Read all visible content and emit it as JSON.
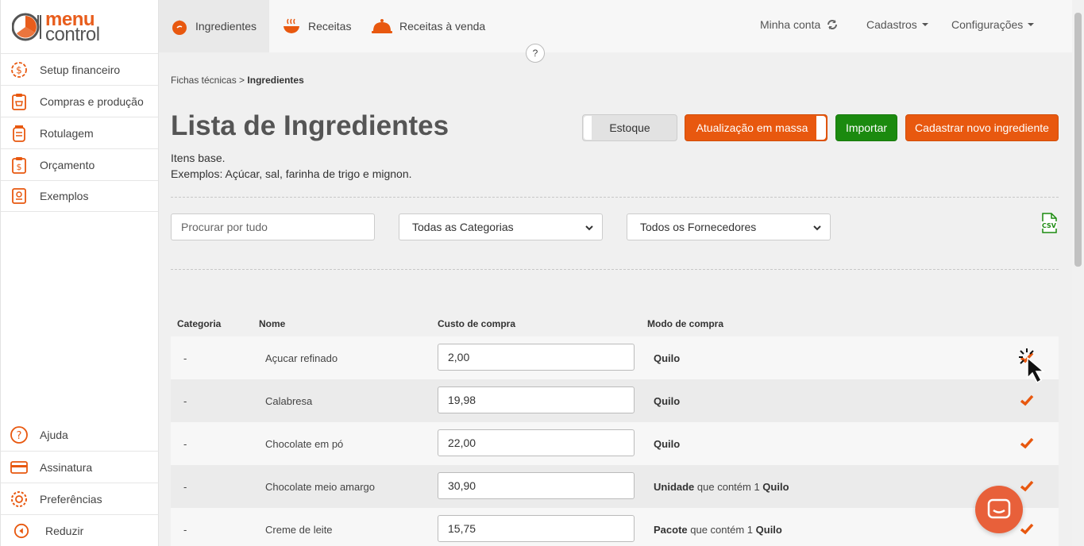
{
  "brand": {
    "logo_line1": "menu",
    "logo_line2": "control"
  },
  "sidebar": {
    "items": [
      {
        "label": "Setup financeiro",
        "icon": "dollar-gear-icon"
      },
      {
        "label": "Compras e produção",
        "icon": "shopping-list-icon"
      },
      {
        "label": "Rotulagem",
        "icon": "jar-label-icon"
      },
      {
        "label": "Orçamento",
        "icon": "budget-clipboard-icon"
      },
      {
        "label": "Exemplos",
        "icon": "recipe-book-icon"
      }
    ],
    "bottom_items": [
      {
        "label": "Ajuda",
        "icon": "help-bubble-icon"
      },
      {
        "label": "Assinatura",
        "icon": "credit-card-icon"
      },
      {
        "label": "Preferências",
        "icon": "gear-icon"
      },
      {
        "label": "Reduzir",
        "icon": "collapse-left-icon"
      }
    ]
  },
  "topnav": {
    "tabs": [
      {
        "label": "Ingredientes",
        "icon": "tomato-icon",
        "active": true
      },
      {
        "label": "Receitas",
        "icon": "cooking-pot-icon",
        "active": false
      },
      {
        "label": "Receitas à venda",
        "icon": "cloche-icon",
        "active": false
      }
    ],
    "account": "Minha conta",
    "cadastros": "Cadastros",
    "config": "Configurações",
    "help": "?"
  },
  "breadcrumb": {
    "parent": "Fichas técnicas",
    "sep": ">",
    "current": "Ingredientes"
  },
  "page": {
    "title": "Lista de Ingredientes",
    "subtitle1": "Itens base.",
    "subtitle2": "Exemplos: Açúcar, sal, farinha de trigo e mignon."
  },
  "actions": {
    "stock": "Estoque",
    "mass_update": "Atualização em massa",
    "import": "Importar",
    "new": "Cadastrar novo ingrediente"
  },
  "filters": {
    "search_placeholder": "Procurar por tudo",
    "categories": "Todas as Categorias",
    "suppliers": "Todos os Fornecedores",
    "csv": "CSV"
  },
  "table": {
    "headers": {
      "category": "Categoria",
      "name": "Nome",
      "cost": "Custo de compra",
      "mode": "Modo de compra"
    },
    "rows": [
      {
        "category": "-",
        "name": "Açucar refinado",
        "cost": "2,00",
        "unit": "Quilo",
        "contains": "",
        "base": ""
      },
      {
        "category": "-",
        "name": "Calabresa",
        "cost": "19,98",
        "unit": "Quilo",
        "contains": "",
        "base": ""
      },
      {
        "category": "-",
        "name": "Chocolate em pó",
        "cost": "22,00",
        "unit": "Quilo",
        "contains": "",
        "base": ""
      },
      {
        "category": "-",
        "name": "Chocolate meio amargo",
        "cost": "30,90",
        "unit": "Unidade",
        "contains": " que contém 1 ",
        "base": "Quilo"
      },
      {
        "category": "-",
        "name": "Creme de leite",
        "cost": "15,75",
        "unit": "Pacote",
        "contains": " que contém 1 ",
        "base": "Quilo"
      }
    ]
  },
  "colors": {
    "accent": "#e8580f",
    "green": "#1b8a0f",
    "chat": "#e8603a"
  }
}
